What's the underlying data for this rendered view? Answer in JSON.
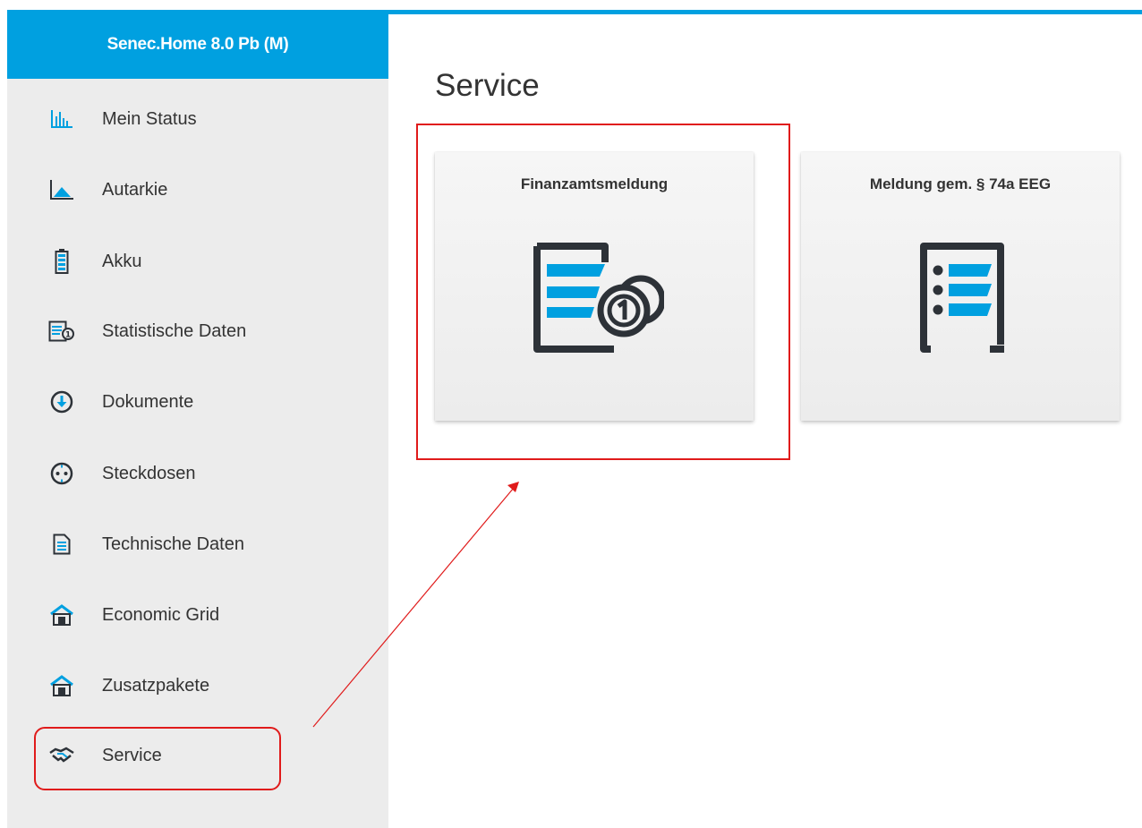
{
  "sidebar": {
    "title": "Senec.Home 8.0 Pb (M)",
    "items": [
      {
        "label": "Mein Status",
        "icon": "bar-chart-icon"
      },
      {
        "label": "Autarkie",
        "icon": "area-chart-icon"
      },
      {
        "label": "Akku",
        "icon": "battery-icon"
      },
      {
        "label": "Statistische Daten",
        "icon": "statistics-document-icon"
      },
      {
        "label": "Dokumente",
        "icon": "download-circle-icon"
      },
      {
        "label": "Steckdosen",
        "icon": "power-socket-icon"
      },
      {
        "label": "Technische Daten",
        "icon": "document-icon"
      },
      {
        "label": "Economic Grid",
        "icon": "house-grid-icon"
      },
      {
        "label": "Zusatzpakete",
        "icon": "house-package-icon"
      },
      {
        "label": "Service",
        "icon": "handshake-icon"
      }
    ]
  },
  "main": {
    "title": "Service",
    "tiles": [
      {
        "title": "Finanzamtsmeldung",
        "icon": "tax-document-coin-icon"
      },
      {
        "title": "Meldung gem. § 74a EEG",
        "icon": "list-document-icon"
      }
    ]
  },
  "colors": {
    "accent": "#00a0e0",
    "sidebar_bg": "#ececec",
    "icon_dark": "#2d3238",
    "annotation": "#e01b1b"
  }
}
